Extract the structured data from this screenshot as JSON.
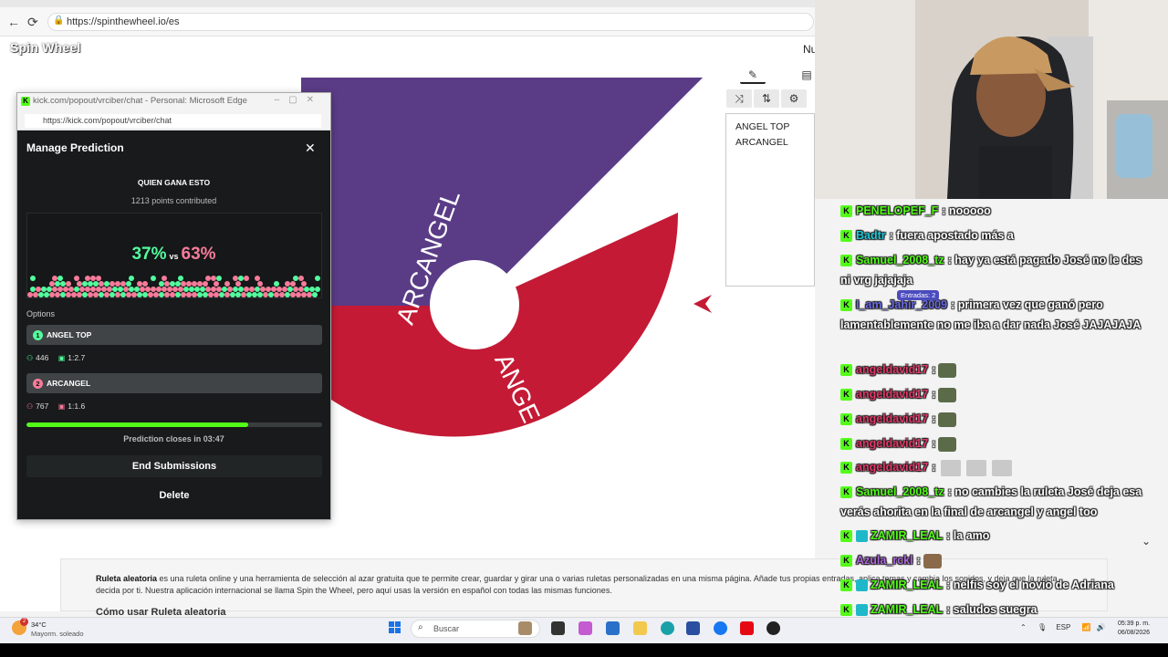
{
  "browser": {
    "url": "https://spinthewheel.io/es",
    "back": "←",
    "refresh": "⟳"
  },
  "site": {
    "logo": "Spin Wheel",
    "nav_partial": "Nu",
    "entries": [
      "ANGEL TOP",
      "ARCANGEL"
    ],
    "wheel": {
      "segments": [
        {
          "label": "ARCANGEL",
          "color": "#5a3c86"
        },
        {
          "label": "ANGEL TOP",
          "color": "#c41a35"
        }
      ]
    },
    "description_bold": "Ruleta aleatoria",
    "description": " es una ruleta online y una herramienta de selección al azar gratuita que te permite crear, guardar y girar una o varias ruletas personalizadas en una misma página. Añade tus propias entradas, aplica temas y cambia los sonidos, y deja que la ruleta decida por ti. Nuestra aplicación internacional se llama Spin the Wheel, pero aquí usas la versión en español con todas las mismas funciones.",
    "heading_partial": "Cómo usar Ruleta aleatoria"
  },
  "popout": {
    "window_title": "kick.com/popout/vrciber/chat - Personal: Microsoft Edge",
    "url": "https://kick.com/popout/vrciber/chat",
    "panel_title": "Manage Prediction",
    "question": "QUIEN GANA ESTO",
    "points": "1213 points contributed",
    "pct_left": "37%",
    "vs": "vs",
    "pct_right": "63%",
    "options_label": "Options",
    "options": [
      {
        "num": "1",
        "name": "ANGEL TOP",
        "users": "446",
        "ratio": "1:2.7",
        "color": "#53fc9e"
      },
      {
        "num": "2",
        "name": "ARCANGEL",
        "users": "767",
        "ratio": "1:1.6",
        "color": "#f77b9a"
      }
    ],
    "progress": 0.75,
    "closes": "Prediction closes in 03:47",
    "end_button": "End Submissions",
    "delete_button": "Delete"
  },
  "chat": {
    "tooltip": "Entradas: 2",
    "messages": [
      {
        "user": "PENELOPEF_F",
        "color": "#53fc18",
        "text": ": nooooo"
      },
      {
        "user": "Badtr",
        "color": "#1fc8d9",
        "text": ": fuera apostado más a"
      },
      {
        "user": "Samuel_2008_tz",
        "color": "#53fc18",
        "text": ": hay ya está pagado José no le des ni vrg jajajaja"
      },
      {
        "user": "I_am_Jahir_2009",
        "color": "#6a6ae8",
        "text": ": primera vez que ganó pero lamentablemente no me iba a dar nada José JAJAJAJA"
      },
      {
        "user": "angeldavid17",
        "color": "#e23a6a",
        "text": ":"
      },
      {
        "user": "angeldavid17",
        "color": "#e23a6a",
        "text": ":"
      },
      {
        "user": "angeldavid17",
        "color": "#e23a6a",
        "text": ":"
      },
      {
        "user": "angeldavid17",
        "color": "#e23a6a",
        "text": ":"
      },
      {
        "user": "angeldavid17",
        "color": "#e23a6a",
        "text": ":"
      },
      {
        "user": "Samuel_2008_tz",
        "color": "#53fc18",
        "text": ": no cambies la ruleta José deja esa verás ahorita en la final de arcangel y angel too"
      },
      {
        "user": "ZAMIR_LEAL",
        "color": "#53fc18",
        "text": ": la amo"
      },
      {
        "user": "Azula_rckl",
        "color": "#b066e0",
        "text": ":"
      },
      {
        "user": "ZAMIR_LEAL",
        "color": "#53fc18",
        "text": ": nelfis soy el novio de Adriana"
      },
      {
        "user": "ZAMIR_LEAL",
        "color": "#53fc18",
        "text": ": saludos suegra"
      }
    ]
  },
  "taskbar": {
    "temp": "34°C",
    "weather": "Mayorm. soleado",
    "weather_badge": "2",
    "search": "Buscar",
    "lang": "ESP",
    "time": "05:39 p. m.",
    "date": "06/08/2026"
  }
}
